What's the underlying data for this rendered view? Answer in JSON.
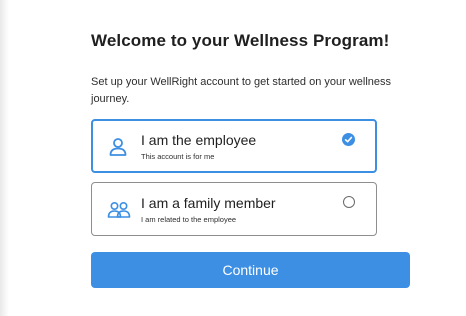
{
  "header": {
    "title": "Welcome to your Wellness Program!",
    "subtitle": "Set up your WellRight account to get started on your wellness journey."
  },
  "options": [
    {
      "label": "I am the employee",
      "description": "This account is for me",
      "selected": true,
      "icon": "person-icon"
    },
    {
      "label": "I am a family member",
      "description": "I am related to the employee",
      "selected": false,
      "icon": "people-icon"
    }
  ],
  "actions": {
    "continue_label": "Continue"
  },
  "colors": {
    "accent": "#3d8fe3",
    "text": "#1f1f1f",
    "border_unselected": "#8e8e8e"
  }
}
